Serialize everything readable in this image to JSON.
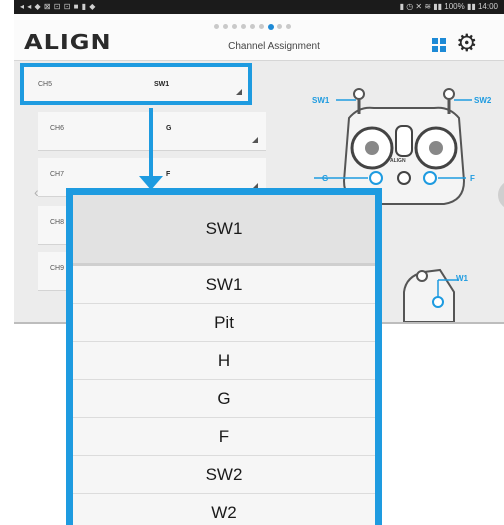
{
  "status_bar": {
    "left": "◂ ◂ ◆ ⊠ ⊡ ⊡ ■ ▮ ◆",
    "right": "▮ ◷ ✕ ≋ ▮▮ 100% ▮▮ 14:00"
  },
  "header": {
    "logo": "ALIGN",
    "title": "Channel Assignment",
    "page_dots": 9,
    "active_dot": 6
  },
  "icons": {
    "apps": "apps-grid-icon",
    "settings": "gear-icon",
    "nav_left": "chevron-left-icon"
  },
  "channels": [
    {
      "num": "CH5",
      "value": "SW1"
    },
    {
      "num": "CH6",
      "value": "G"
    },
    {
      "num": "CH7",
      "value": "F"
    },
    {
      "num": "CH8",
      "value": ""
    },
    {
      "num": "CH9",
      "value": ""
    }
  ],
  "controller_labels": {
    "sw1": "SW1",
    "sw2": "SW2",
    "g": "G",
    "f": "F",
    "w1": "W1",
    "brand": "ALIGN"
  },
  "dropdown": {
    "selected": "SW1",
    "options": [
      "SW1",
      "Pit",
      "H",
      "G",
      "F",
      "SW2",
      "W2"
    ]
  },
  "colors": {
    "accent": "#1e9be0",
    "background": "#ececec"
  }
}
